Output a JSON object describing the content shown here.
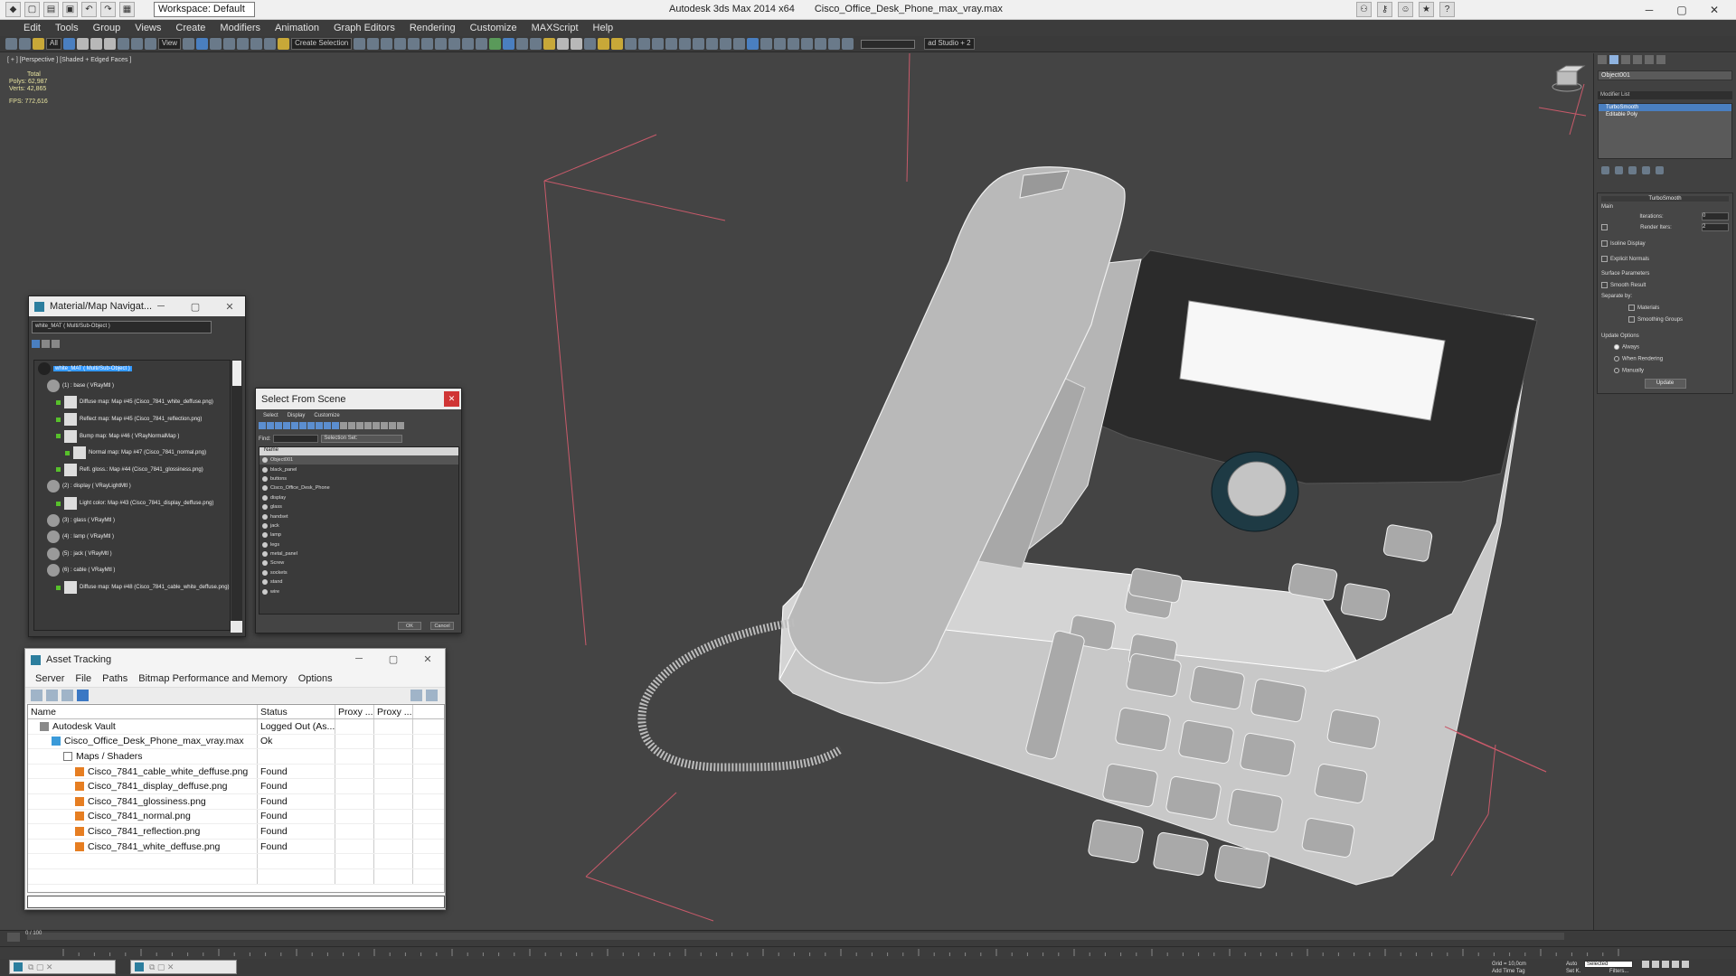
{
  "app": {
    "title": "Autodesk 3ds Max  2014 x64",
    "file": "Cisco_Office_Desk_Phone_max_vray.max",
    "workspace": "Workspace: Default"
  },
  "menu": [
    "Edit",
    "Tools",
    "Group",
    "Views",
    "Create",
    "Modifiers",
    "Animation",
    "Graph Editors",
    "Rendering",
    "Customize",
    "MAXScript",
    "Help"
  ],
  "toolbar": {
    "selection_filter": "All",
    "view_ref": "View",
    "create_selection_set": "Create Selection",
    "render_preset": "ad Studio + 2"
  },
  "viewport": {
    "label": "[ + ] [Perspective ] [Shaded + Edged Faces ]",
    "stats": {
      "total_label": "Total",
      "polys_label": "Polys:",
      "polys": "62,987",
      "verts_label": "Verts:",
      "verts": "42,865",
      "fps_label": "FPS:",
      "fps": "772,616"
    }
  },
  "command_panel": {
    "object_name": "Object001",
    "modifier_list": "Modifier List",
    "stack": [
      "TurboSmooth",
      "Editable Poly"
    ],
    "turbosmooth": {
      "title": "TurboSmooth",
      "main": "Main",
      "iterations_label": "Iterations:",
      "iterations": "0",
      "render_iters_label": "Render Iters:",
      "render_iters": "2",
      "isoline": "Isoline Display",
      "explicit": "Explicit Normals",
      "surface_params": "Surface Parameters",
      "smooth_result": "Smooth Result",
      "separate_by": "Separate by:",
      "materials": "Materials",
      "smoothing_groups": "Smoothing Groups",
      "update_options": "Update Options",
      "always": "Always",
      "when_rendering": "When Rendering",
      "manually": "Manually",
      "update": "Update"
    }
  },
  "material_navigator": {
    "title": "Material/Map Navigat...",
    "field": "white_MAT ( Multi/Sub-Object )",
    "items": [
      {
        "label": "white_MAT ( Multi/Sub-Object )",
        "kind": "root",
        "indent": 0
      },
      {
        "label": "(1) : base ( VRayMtl )",
        "kind": "mtl",
        "indent": 1
      },
      {
        "label": "Diffuse map: Map #45 (Cisco_7841_white_deffuse.png)",
        "kind": "map",
        "indent": 2
      },
      {
        "label": "Reflect map: Map #45 (Cisco_7841_reflection.png)",
        "kind": "map",
        "indent": 2
      },
      {
        "label": "Bump map: Map #46 ( VRayNormalMap )",
        "kind": "map",
        "indent": 2
      },
      {
        "label": "Normal map: Map #47 (Cisco_7841_normal.png)",
        "kind": "map",
        "indent": 3
      },
      {
        "label": "Refl. gloss.: Map #44 (Cisco_7841_glossiness.png)",
        "kind": "map",
        "indent": 2
      },
      {
        "label": "(2) : display ( VRayLightMtl )",
        "kind": "mtl",
        "indent": 1
      },
      {
        "label": "Light color: Map #43 (Cisco_7841_display_deffuse.png)",
        "kind": "map",
        "indent": 2
      },
      {
        "label": "(3) : glass ( VRayMtl )",
        "kind": "mtl",
        "indent": 1
      },
      {
        "label": "(4) : lamp ( VRayMtl )",
        "kind": "mtl",
        "indent": 1
      },
      {
        "label": "(5) : jack ( VRayMtl )",
        "kind": "mtl",
        "indent": 1
      },
      {
        "label": "(6) : cable ( VRayMtl )",
        "kind": "mtl",
        "indent": 1
      },
      {
        "label": "Diffuse map: Map #48 (Cisco_7841_cable_white_deffuse.png)",
        "kind": "map",
        "indent": 2
      }
    ]
  },
  "select_from_scene": {
    "title": "Select From Scene",
    "menu": [
      "Select",
      "Display",
      "Customize"
    ],
    "find_label": "Find:",
    "selection_set": "Selection Set:",
    "col_name": "Name",
    "items": [
      "Object001",
      "black_panel",
      "buttons",
      "Cisco_Office_Desk_Phone",
      "display",
      "glass",
      "handset",
      "jack",
      "lamp",
      "legs",
      "metal_panel",
      "Screw",
      "sockets",
      "stand",
      "wire"
    ],
    "ok": "OK",
    "cancel": "Cancel"
  },
  "asset_tracking": {
    "title": "Asset Tracking",
    "menu": [
      "Server",
      "File",
      "Paths",
      "Bitmap Performance and Memory",
      "Options"
    ],
    "columns": [
      "Name",
      "Status",
      "Proxy ...",
      "Proxy ..."
    ],
    "rows": [
      {
        "name": "Autodesk Vault",
        "status": "Logged Out (As...",
        "indent": 1,
        "icon": "vault"
      },
      {
        "name": "Cisco_Office_Desk_Phone_max_vray.max",
        "status": "Ok",
        "indent": 2,
        "icon": "max"
      },
      {
        "name": "Maps / Shaders",
        "status": "",
        "indent": 3,
        "icon": "folder"
      },
      {
        "name": "Cisco_7841_cable_white_deffuse.png",
        "status": "Found",
        "indent": 4,
        "icon": "image"
      },
      {
        "name": "Cisco_7841_display_deffuse.png",
        "status": "Found",
        "indent": 4,
        "icon": "image"
      },
      {
        "name": "Cisco_7841_glossiness.png",
        "status": "Found",
        "indent": 4,
        "icon": "image"
      },
      {
        "name": "Cisco_7841_normal.png",
        "status": "Found",
        "indent": 4,
        "icon": "image"
      },
      {
        "name": "Cisco_7841_reflection.png",
        "status": "Found",
        "indent": 4,
        "icon": "image"
      },
      {
        "name": "Cisco_7841_white_deffuse.png",
        "status": "Found",
        "indent": 4,
        "icon": "image"
      }
    ]
  },
  "timeline": {
    "frame": "0 / 100"
  },
  "status": {
    "selected": "Selected",
    "add_time_tag": "Add Time Tag",
    "grid": "Grid = 10,0cm",
    "auto": "Auto",
    "set_k": "Set K.",
    "filters": "Filters..."
  },
  "colors": {
    "accent": "#3399ff",
    "viewport_bg": "#444444",
    "grid_line": "#c85a6a",
    "found_ok": "#57c02b"
  }
}
